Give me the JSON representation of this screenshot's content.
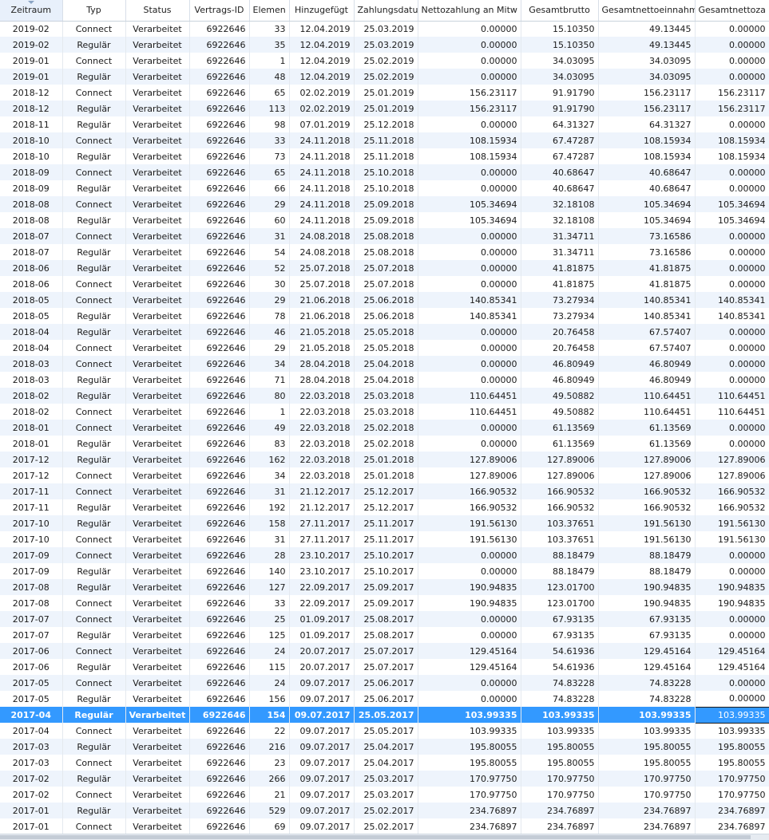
{
  "columns": [
    "Zeitraum",
    "Typ",
    "Status",
    "Vertrags-ID",
    "Elemen",
    "Hinzugefügt",
    "Zahlungsdatu",
    "Nettozahlung an Mitw",
    "Gesamtbrutto",
    "Gesamtnettoeinnahm",
    "Gesamtnettoza"
  ],
  "sorted_column_index": 0,
  "selected_row_index": 43,
  "rows": [
    [
      "2019-02",
      "Connect",
      "Verarbeitet",
      "6922646",
      "33",
      "12.04.2019",
      "25.03.2019",
      "0.00000",
      "15.10350",
      "49.13445",
      "0.00000"
    ],
    [
      "2019-02",
      "Regulär",
      "Verarbeitet",
      "6922646",
      "35",
      "12.04.2019",
      "25.03.2019",
      "0.00000",
      "15.10350",
      "49.13445",
      "0.00000"
    ],
    [
      "2019-01",
      "Connect",
      "Verarbeitet",
      "6922646",
      "1",
      "12.04.2019",
      "25.02.2019",
      "0.00000",
      "34.03095",
      "34.03095",
      "0.00000"
    ],
    [
      "2019-01",
      "Regulär",
      "Verarbeitet",
      "6922646",
      "48",
      "12.04.2019",
      "25.02.2019",
      "0.00000",
      "34.03095",
      "34.03095",
      "0.00000"
    ],
    [
      "2018-12",
      "Connect",
      "Verarbeitet",
      "6922646",
      "65",
      "02.02.2019",
      "25.01.2019",
      "156.23117",
      "91.91790",
      "156.23117",
      "156.23117"
    ],
    [
      "2018-12",
      "Regulär",
      "Verarbeitet",
      "6922646",
      "113",
      "02.02.2019",
      "25.01.2019",
      "156.23117",
      "91.91790",
      "156.23117",
      "156.23117"
    ],
    [
      "2018-11",
      "Regulär",
      "Verarbeitet",
      "6922646",
      "98",
      "07.01.2019",
      "25.12.2018",
      "0.00000",
      "64.31327",
      "64.31327",
      "0.00000"
    ],
    [
      "2018-10",
      "Connect",
      "Verarbeitet",
      "6922646",
      "33",
      "24.11.2018",
      "25.11.2018",
      "108.15934",
      "67.47287",
      "108.15934",
      "108.15934"
    ],
    [
      "2018-10",
      "Regulär",
      "Verarbeitet",
      "6922646",
      "73",
      "24.11.2018",
      "25.11.2018",
      "108.15934",
      "67.47287",
      "108.15934",
      "108.15934"
    ],
    [
      "2018-09",
      "Connect",
      "Verarbeitet",
      "6922646",
      "65",
      "24.11.2018",
      "25.10.2018",
      "0.00000",
      "40.68647",
      "40.68647",
      "0.00000"
    ],
    [
      "2018-09",
      "Regulär",
      "Verarbeitet",
      "6922646",
      "66",
      "24.11.2018",
      "25.10.2018",
      "0.00000",
      "40.68647",
      "40.68647",
      "0.00000"
    ],
    [
      "2018-08",
      "Connect",
      "Verarbeitet",
      "6922646",
      "29",
      "24.11.2018",
      "25.09.2018",
      "105.34694",
      "32.18108",
      "105.34694",
      "105.34694"
    ],
    [
      "2018-08",
      "Regulär",
      "Verarbeitet",
      "6922646",
      "60",
      "24.11.2018",
      "25.09.2018",
      "105.34694",
      "32.18108",
      "105.34694",
      "105.34694"
    ],
    [
      "2018-07",
      "Connect",
      "Verarbeitet",
      "6922646",
      "31",
      "24.08.2018",
      "25.08.2018",
      "0.00000",
      "31.34711",
      "73.16586",
      "0.00000"
    ],
    [
      "2018-07",
      "Regulär",
      "Verarbeitet",
      "6922646",
      "54",
      "24.08.2018",
      "25.08.2018",
      "0.00000",
      "31.34711",
      "73.16586",
      "0.00000"
    ],
    [
      "2018-06",
      "Regulär",
      "Verarbeitet",
      "6922646",
      "52",
      "25.07.2018",
      "25.07.2018",
      "0.00000",
      "41.81875",
      "41.81875",
      "0.00000"
    ],
    [
      "2018-06",
      "Connect",
      "Verarbeitet",
      "6922646",
      "30",
      "25.07.2018",
      "25.07.2018",
      "0.00000",
      "41.81875",
      "41.81875",
      "0.00000"
    ],
    [
      "2018-05",
      "Connect",
      "Verarbeitet",
      "6922646",
      "29",
      "21.06.2018",
      "25.06.2018",
      "140.85341",
      "73.27934",
      "140.85341",
      "140.85341"
    ],
    [
      "2018-05",
      "Regulär",
      "Verarbeitet",
      "6922646",
      "78",
      "21.06.2018",
      "25.06.2018",
      "140.85341",
      "73.27934",
      "140.85341",
      "140.85341"
    ],
    [
      "2018-04",
      "Regulär",
      "Verarbeitet",
      "6922646",
      "46",
      "21.05.2018",
      "25.05.2018",
      "0.00000",
      "20.76458",
      "67.57407",
      "0.00000"
    ],
    [
      "2018-04",
      "Connect",
      "Verarbeitet",
      "6922646",
      "29",
      "21.05.2018",
      "25.05.2018",
      "0.00000",
      "20.76458",
      "67.57407",
      "0.00000"
    ],
    [
      "2018-03",
      "Connect",
      "Verarbeitet",
      "6922646",
      "34",
      "28.04.2018",
      "25.04.2018",
      "0.00000",
      "46.80949",
      "46.80949",
      "0.00000"
    ],
    [
      "2018-03",
      "Regulär",
      "Verarbeitet",
      "6922646",
      "71",
      "28.04.2018",
      "25.04.2018",
      "0.00000",
      "46.80949",
      "46.80949",
      "0.00000"
    ],
    [
      "2018-02",
      "Regulär",
      "Verarbeitet",
      "6922646",
      "80",
      "22.03.2018",
      "25.03.2018",
      "110.64451",
      "49.50882",
      "110.64451",
      "110.64451"
    ],
    [
      "2018-02",
      "Connect",
      "Verarbeitet",
      "6922646",
      "1",
      "22.03.2018",
      "25.03.2018",
      "110.64451",
      "49.50882",
      "110.64451",
      "110.64451"
    ],
    [
      "2018-01",
      "Connect",
      "Verarbeitet",
      "6922646",
      "49",
      "22.03.2018",
      "25.02.2018",
      "0.00000",
      "61.13569",
      "61.13569",
      "0.00000"
    ],
    [
      "2018-01",
      "Regulär",
      "Verarbeitet",
      "6922646",
      "83",
      "22.03.2018",
      "25.02.2018",
      "0.00000",
      "61.13569",
      "61.13569",
      "0.00000"
    ],
    [
      "2017-12",
      "Regulär",
      "Verarbeitet",
      "6922646",
      "162",
      "22.03.2018",
      "25.01.2018",
      "127.89006",
      "127.89006",
      "127.89006",
      "127.89006"
    ],
    [
      "2017-12",
      "Connect",
      "Verarbeitet",
      "6922646",
      "34",
      "22.03.2018",
      "25.01.2018",
      "127.89006",
      "127.89006",
      "127.89006",
      "127.89006"
    ],
    [
      "2017-11",
      "Connect",
      "Verarbeitet",
      "6922646",
      "31",
      "21.12.2017",
      "25.12.2017",
      "166.90532",
      "166.90532",
      "166.90532",
      "166.90532"
    ],
    [
      "2017-11",
      "Regulär",
      "Verarbeitet",
      "6922646",
      "192",
      "21.12.2017",
      "25.12.2017",
      "166.90532",
      "166.90532",
      "166.90532",
      "166.90532"
    ],
    [
      "2017-10",
      "Regulär",
      "Verarbeitet",
      "6922646",
      "158",
      "27.11.2017",
      "25.11.2017",
      "191.56130",
      "103.37651",
      "191.56130",
      "191.56130"
    ],
    [
      "2017-10",
      "Connect",
      "Verarbeitet",
      "6922646",
      "31",
      "27.11.2017",
      "25.11.2017",
      "191.56130",
      "103.37651",
      "191.56130",
      "191.56130"
    ],
    [
      "2017-09",
      "Connect",
      "Verarbeitet",
      "6922646",
      "28",
      "23.10.2017",
      "25.10.2017",
      "0.00000",
      "88.18479",
      "88.18479",
      "0.00000"
    ],
    [
      "2017-09",
      "Regulär",
      "Verarbeitet",
      "6922646",
      "140",
      "23.10.2017",
      "25.10.2017",
      "0.00000",
      "88.18479",
      "88.18479",
      "0.00000"
    ],
    [
      "2017-08",
      "Regulär",
      "Verarbeitet",
      "6922646",
      "127",
      "22.09.2017",
      "25.09.2017",
      "190.94835",
      "123.01700",
      "190.94835",
      "190.94835"
    ],
    [
      "2017-08",
      "Connect",
      "Verarbeitet",
      "6922646",
      "33",
      "22.09.2017",
      "25.09.2017",
      "190.94835",
      "123.01700",
      "190.94835",
      "190.94835"
    ],
    [
      "2017-07",
      "Connect",
      "Verarbeitet",
      "6922646",
      "25",
      "01.09.2017",
      "25.08.2017",
      "0.00000",
      "67.93135",
      "67.93135",
      "0.00000"
    ],
    [
      "2017-07",
      "Regulär",
      "Verarbeitet",
      "6922646",
      "125",
      "01.09.2017",
      "25.08.2017",
      "0.00000",
      "67.93135",
      "67.93135",
      "0.00000"
    ],
    [
      "2017-06",
      "Connect",
      "Verarbeitet",
      "6922646",
      "24",
      "20.07.2017",
      "25.07.2017",
      "129.45164",
      "54.61936",
      "129.45164",
      "129.45164"
    ],
    [
      "2017-06",
      "Regulär",
      "Verarbeitet",
      "6922646",
      "115",
      "20.07.2017",
      "25.07.2017",
      "129.45164",
      "54.61936",
      "129.45164",
      "129.45164"
    ],
    [
      "2017-05",
      "Connect",
      "Verarbeitet",
      "6922646",
      "24",
      "09.07.2017",
      "25.06.2017",
      "0.00000",
      "74.83228",
      "74.83228",
      "0.00000"
    ],
    [
      "2017-05",
      "Regulär",
      "Verarbeitet",
      "6922646",
      "156",
      "09.07.2017",
      "25.06.2017",
      "0.00000",
      "74.83228",
      "74.83228",
      "0.00000"
    ],
    [
      "2017-04",
      "Regulär",
      "Verarbeitet",
      "6922646",
      "154",
      "09.07.2017",
      "25.05.2017",
      "103.99335",
      "103.99335",
      "103.99335",
      "103.99335"
    ],
    [
      "2017-04",
      "Connect",
      "Verarbeitet",
      "6922646",
      "22",
      "09.07.2017",
      "25.05.2017",
      "103.99335",
      "103.99335",
      "103.99335",
      "103.99335"
    ],
    [
      "2017-03",
      "Regulär",
      "Verarbeitet",
      "6922646",
      "216",
      "09.07.2017",
      "25.04.2017",
      "195.80055",
      "195.80055",
      "195.80055",
      "195.80055"
    ],
    [
      "2017-03",
      "Connect",
      "Verarbeitet",
      "6922646",
      "23",
      "09.07.2017",
      "25.04.2017",
      "195.80055",
      "195.80055",
      "195.80055",
      "195.80055"
    ],
    [
      "2017-02",
      "Regulär",
      "Verarbeitet",
      "6922646",
      "266",
      "09.07.2017",
      "25.03.2017",
      "170.97750",
      "170.97750",
      "170.97750",
      "170.97750"
    ],
    [
      "2017-02",
      "Connect",
      "Verarbeitet",
      "6922646",
      "21",
      "09.07.2017",
      "25.03.2017",
      "170.97750",
      "170.97750",
      "170.97750",
      "170.97750"
    ],
    [
      "2017-01",
      "Regulär",
      "Verarbeitet",
      "6922646",
      "529",
      "09.07.2017",
      "25.02.2017",
      "234.76897",
      "234.76897",
      "234.76897",
      "234.76897"
    ],
    [
      "2017-01",
      "Connect",
      "Verarbeitet",
      "6922646",
      "69",
      "09.07.2017",
      "25.02.2017",
      "234.76897",
      "234.76897",
      "234.76897",
      "234.76897"
    ]
  ]
}
